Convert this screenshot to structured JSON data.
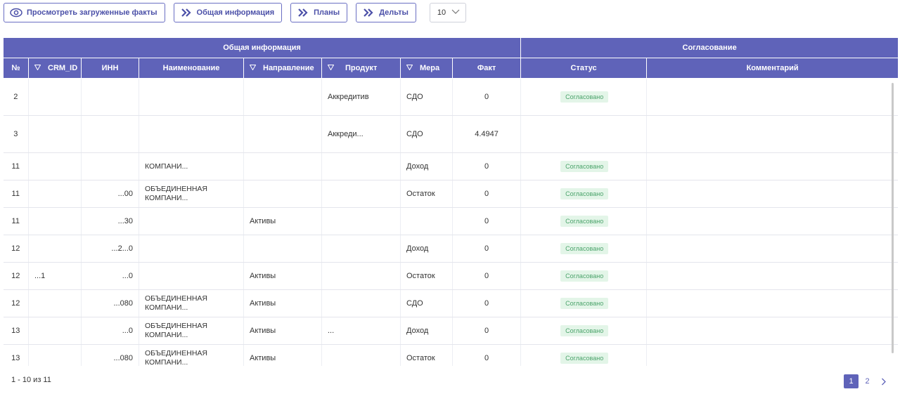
{
  "toolbar": {
    "view_facts": "Просмотреть загруженные факты",
    "general_info": "Общая информация",
    "plans": "Планы",
    "deltas": "Дельты",
    "page_size": "10"
  },
  "table": {
    "group_general": "Общая информация",
    "group_approval": "Согласование",
    "columns": {
      "num": "№",
      "crm_id": "CRM_ID",
      "inn": "ИНН",
      "name": "Наименование",
      "direction": "Направление",
      "product": "Продукт",
      "measure": "Мера",
      "fact": "Факт",
      "status": "Статус",
      "comment": "Комментарий"
    },
    "rows": [
      {
        "num": "2",
        "crm_id": "",
        "inn": "",
        "name": "",
        "direction": "",
        "product": "Аккредитив",
        "measure": "СДО",
        "fact": "0",
        "status": "Согласовано",
        "comment": ""
      },
      {
        "num": "3",
        "crm_id": "",
        "inn": "",
        "name": "",
        "direction": "",
        "product": "Аккреди...",
        "measure": "СДО",
        "fact": "4.4947",
        "status": "",
        "comment": ""
      },
      {
        "num": "11",
        "crm_id": "",
        "inn": "",
        "name": "КОМПАНИ...",
        "direction": "",
        "product": "",
        "measure": "Доход",
        "fact": "0",
        "status": "Согласовано",
        "comment": ""
      },
      {
        "num": "11",
        "crm_id": "",
        "inn": "...00",
        "name": "ОБЪЕДИНЕННАЯ КОМПАНИ...",
        "direction": "",
        "product": "",
        "measure": "Остаток",
        "fact": "0",
        "status": "Согласовано",
        "comment": ""
      },
      {
        "num": "11",
        "crm_id": "",
        "inn": "...30",
        "name": "",
        "direction": "Активы",
        "product": "",
        "measure": "",
        "fact": "0",
        "status": "Согласовано",
        "comment": ""
      },
      {
        "num": "12",
        "crm_id": "",
        "inn": "...2...0",
        "name": "",
        "direction": "",
        "product": "",
        "measure": "Доход",
        "fact": "0",
        "status": "Согласовано",
        "comment": ""
      },
      {
        "num": "12",
        "crm_id": "...1",
        "inn": "...0",
        "name": "",
        "direction": "Активы",
        "product": "",
        "measure": "Остаток",
        "fact": "0",
        "status": "Согласовано",
        "comment": ""
      },
      {
        "num": "12",
        "crm_id": "",
        "inn": "...080",
        "name": "ОБЪЕДИНЕННАЯ КОМПАНИ...",
        "direction": "Активы",
        "product": "",
        "measure": "СДО",
        "fact": "0",
        "status": "Согласовано",
        "comment": ""
      },
      {
        "num": "13",
        "crm_id": "",
        "inn": "...0",
        "name": "ОБЪЕДИНЕННАЯ КОМПАНИ...",
        "direction": "Активы",
        "product": "...",
        "measure": "Доход",
        "fact": "0",
        "status": "Согласовано",
        "comment": ""
      },
      {
        "num": "13",
        "crm_id": "",
        "inn": "...080",
        "name": "ОБЪЕДИНЕННАЯ КОМПАНИ...",
        "direction": "Активы",
        "product": "",
        "measure": "Остаток",
        "fact": "0",
        "status": "Согласовано",
        "comment": ""
      }
    ]
  },
  "footer": {
    "count": "1 - 10 из 11",
    "pages": [
      "1",
      "2"
    ],
    "active_page": "1"
  },
  "colors": {
    "header": "#5f63b9",
    "accent": "#4b50a8",
    "badge_bg": "#e3f5e8",
    "badge_text": "#4aa36a"
  },
  "icons": {
    "view": "eye-icon",
    "nav": "double-chevron-right-icon",
    "dropdown": "chevron-down-icon",
    "filter": "filter-icon",
    "next": "chevron-right-icon"
  }
}
